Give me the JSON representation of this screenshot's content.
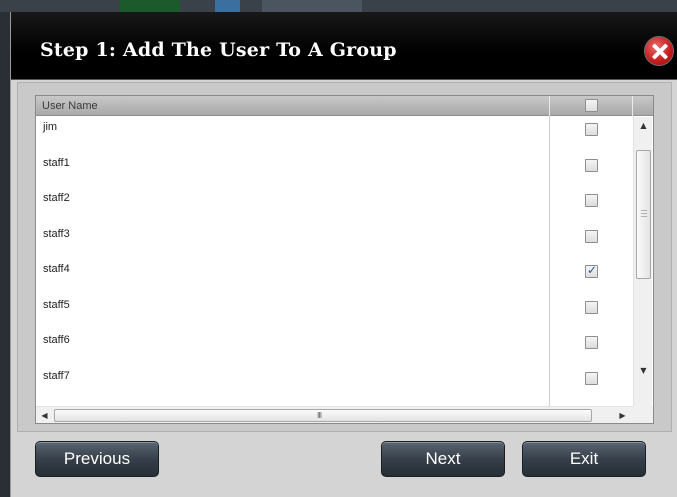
{
  "dialog": {
    "title": "Step 1: Add The User To A Group"
  },
  "table": {
    "columns": [
      "User Name",
      ""
    ],
    "rows": [
      {
        "user": "jim",
        "checked": false
      },
      {
        "user": "staff1",
        "checked": false
      },
      {
        "user": "staff2",
        "checked": false
      },
      {
        "user": "staff3",
        "checked": false
      },
      {
        "user": "staff4",
        "checked": true
      },
      {
        "user": "staff5",
        "checked": false
      },
      {
        "user": "staff6",
        "checked": false
      },
      {
        "user": "staff7",
        "checked": false
      }
    ],
    "select_all_checked": false,
    "hscroll_grip": "III"
  },
  "buttons": {
    "previous": "Previous",
    "next": "Next",
    "exit": "Exit"
  },
  "icons": {
    "close": "close-icon",
    "scroll_up": "arrow-up-icon",
    "scroll_down": "arrow-down-icon",
    "scroll_left": "arrow-left-icon",
    "scroll_right": "arrow-right-icon"
  },
  "colors": {
    "title_bar": "#000000",
    "close_button": "#c41b1b",
    "button": "#37404a",
    "check_mark": "#2a4fa8"
  }
}
